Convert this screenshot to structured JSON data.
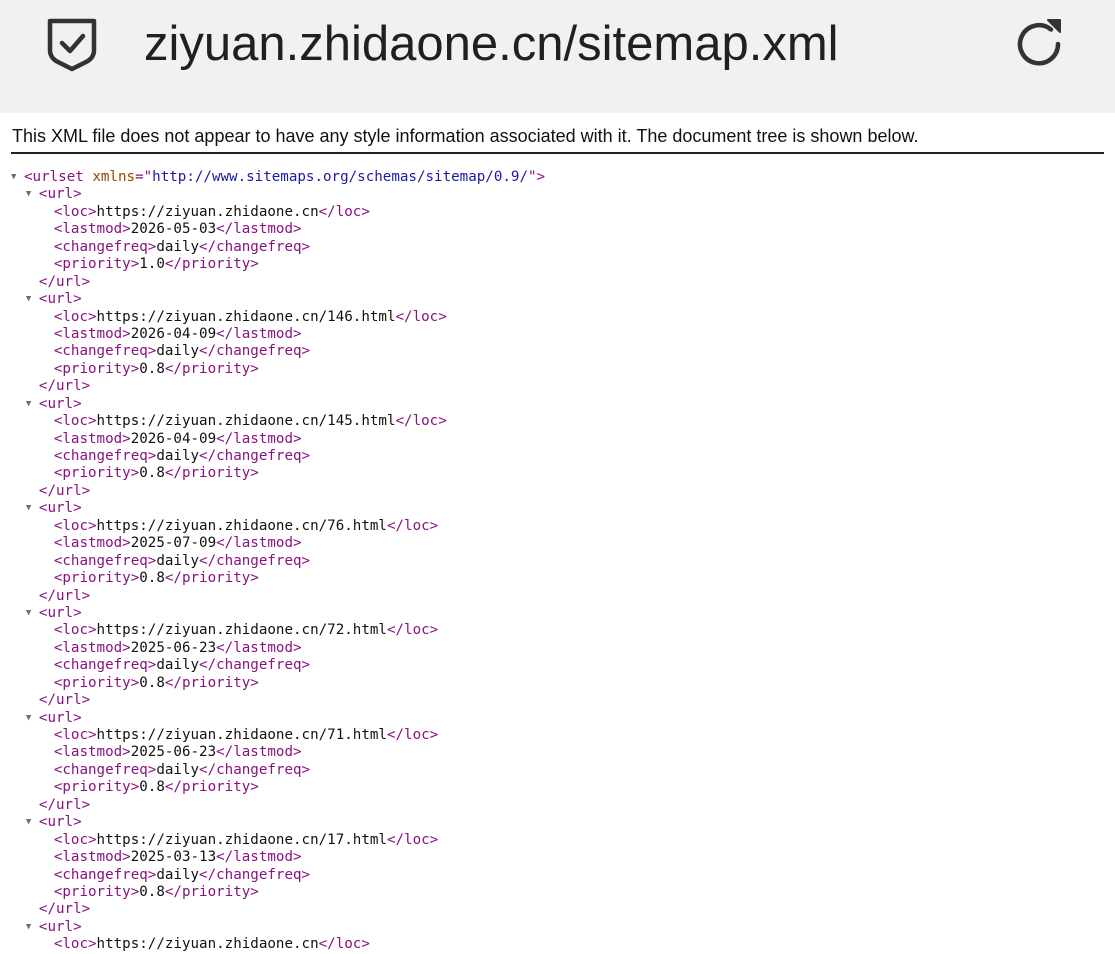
{
  "browser": {
    "url": "ziyuan.zhidaone.cn/sitemap.xml",
    "security_icon": "shield-check-icon",
    "reload_icon": "reload-icon"
  },
  "notice": "This XML file does not appear to have any style information associated with it. The document tree is shown below.",
  "tree": {
    "toggle_glyph": "▼",
    "root_open": "<urlset",
    "root_attr_name": "xmlns",
    "root_attr_eq": "=\"",
    "root_attr_value": "http://www.sitemaps.org/schemas/sitemap/0.9/",
    "root_attr_end": "\">",
    "url_open": "<url>",
    "url_close": "</url>",
    "loc_open": "<loc>",
    "loc_close": "</loc>",
    "lastmod_open": "<lastmod>",
    "lastmod_close": "</lastmod>",
    "changefreq_open": "<changefreq>",
    "changefreq_close": "</changefreq>",
    "priority_open": "<priority>",
    "priority_close": "</priority>",
    "urls": [
      {
        "loc": "https://ziyuan.zhidaone.cn",
        "lastmod": "2026-05-03",
        "changefreq": "daily",
        "priority": "1.0"
      },
      {
        "loc": "https://ziyuan.zhidaone.cn/146.html",
        "lastmod": "2026-04-09",
        "changefreq": "daily",
        "priority": "0.8"
      },
      {
        "loc": "https://ziyuan.zhidaone.cn/145.html",
        "lastmod": "2026-04-09",
        "changefreq": "daily",
        "priority": "0.8"
      },
      {
        "loc": "https://ziyuan.zhidaone.cn/76.html",
        "lastmod": "2025-07-09",
        "changefreq": "daily",
        "priority": "0.8"
      },
      {
        "loc": "https://ziyuan.zhidaone.cn/72.html",
        "lastmod": "2025-06-23",
        "changefreq": "daily",
        "priority": "0.8"
      },
      {
        "loc": "https://ziyuan.zhidaone.cn/71.html",
        "lastmod": "2025-06-23",
        "changefreq": "daily",
        "priority": "0.8"
      },
      {
        "loc": "https://ziyuan.zhidaone.cn/17.html",
        "lastmod": "2025-03-13",
        "changefreq": "daily",
        "priority": "0.8"
      },
      {
        "loc": "https://ziyuan.zhidaone.cn",
        "lastmod": "",
        "changefreq": "",
        "priority": ""
      }
    ]
  }
}
